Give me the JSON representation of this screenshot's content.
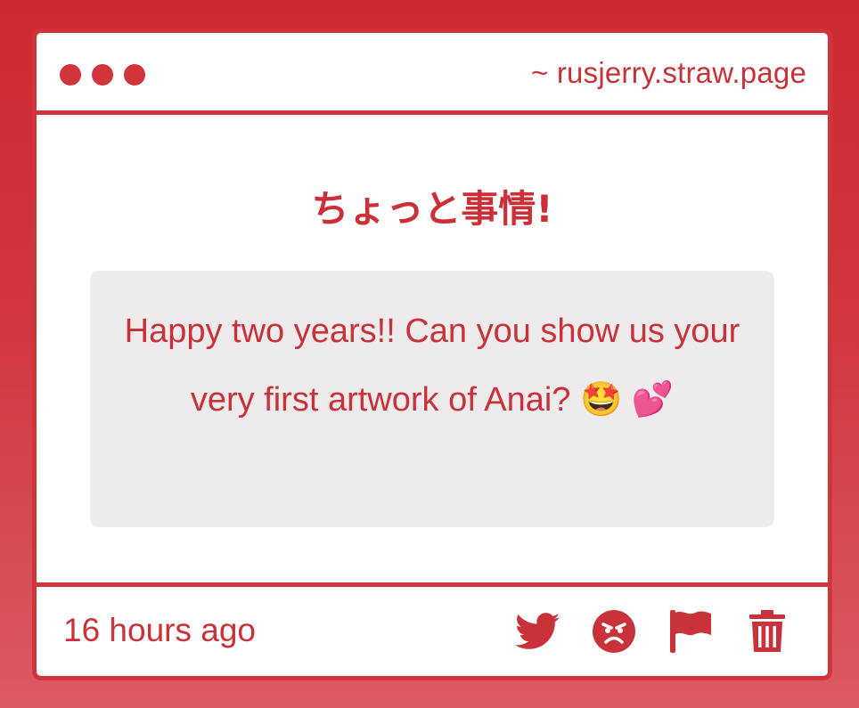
{
  "window": {
    "url": "~ rusjerry.straw.page"
  },
  "post": {
    "title": "ちょっと事情!",
    "message": "Happy two years!! Can you show us your very first artwork of Anai? 🤩 💕",
    "timestamp": "16 hours ago"
  },
  "actions": [
    {
      "name": "share-twitter",
      "icon": "twitter-bird-icon"
    },
    {
      "name": "react-angry",
      "icon": "angry-face-icon"
    },
    {
      "name": "report",
      "icon": "flag-icon"
    },
    {
      "name": "delete",
      "icon": "trash-icon"
    }
  ],
  "colors": {
    "accent": "#d1343b",
    "text": "#c83238",
    "message_bg": "#edebec",
    "background_top": "#cc2a30",
    "background_bottom": "#dc5a63"
  }
}
